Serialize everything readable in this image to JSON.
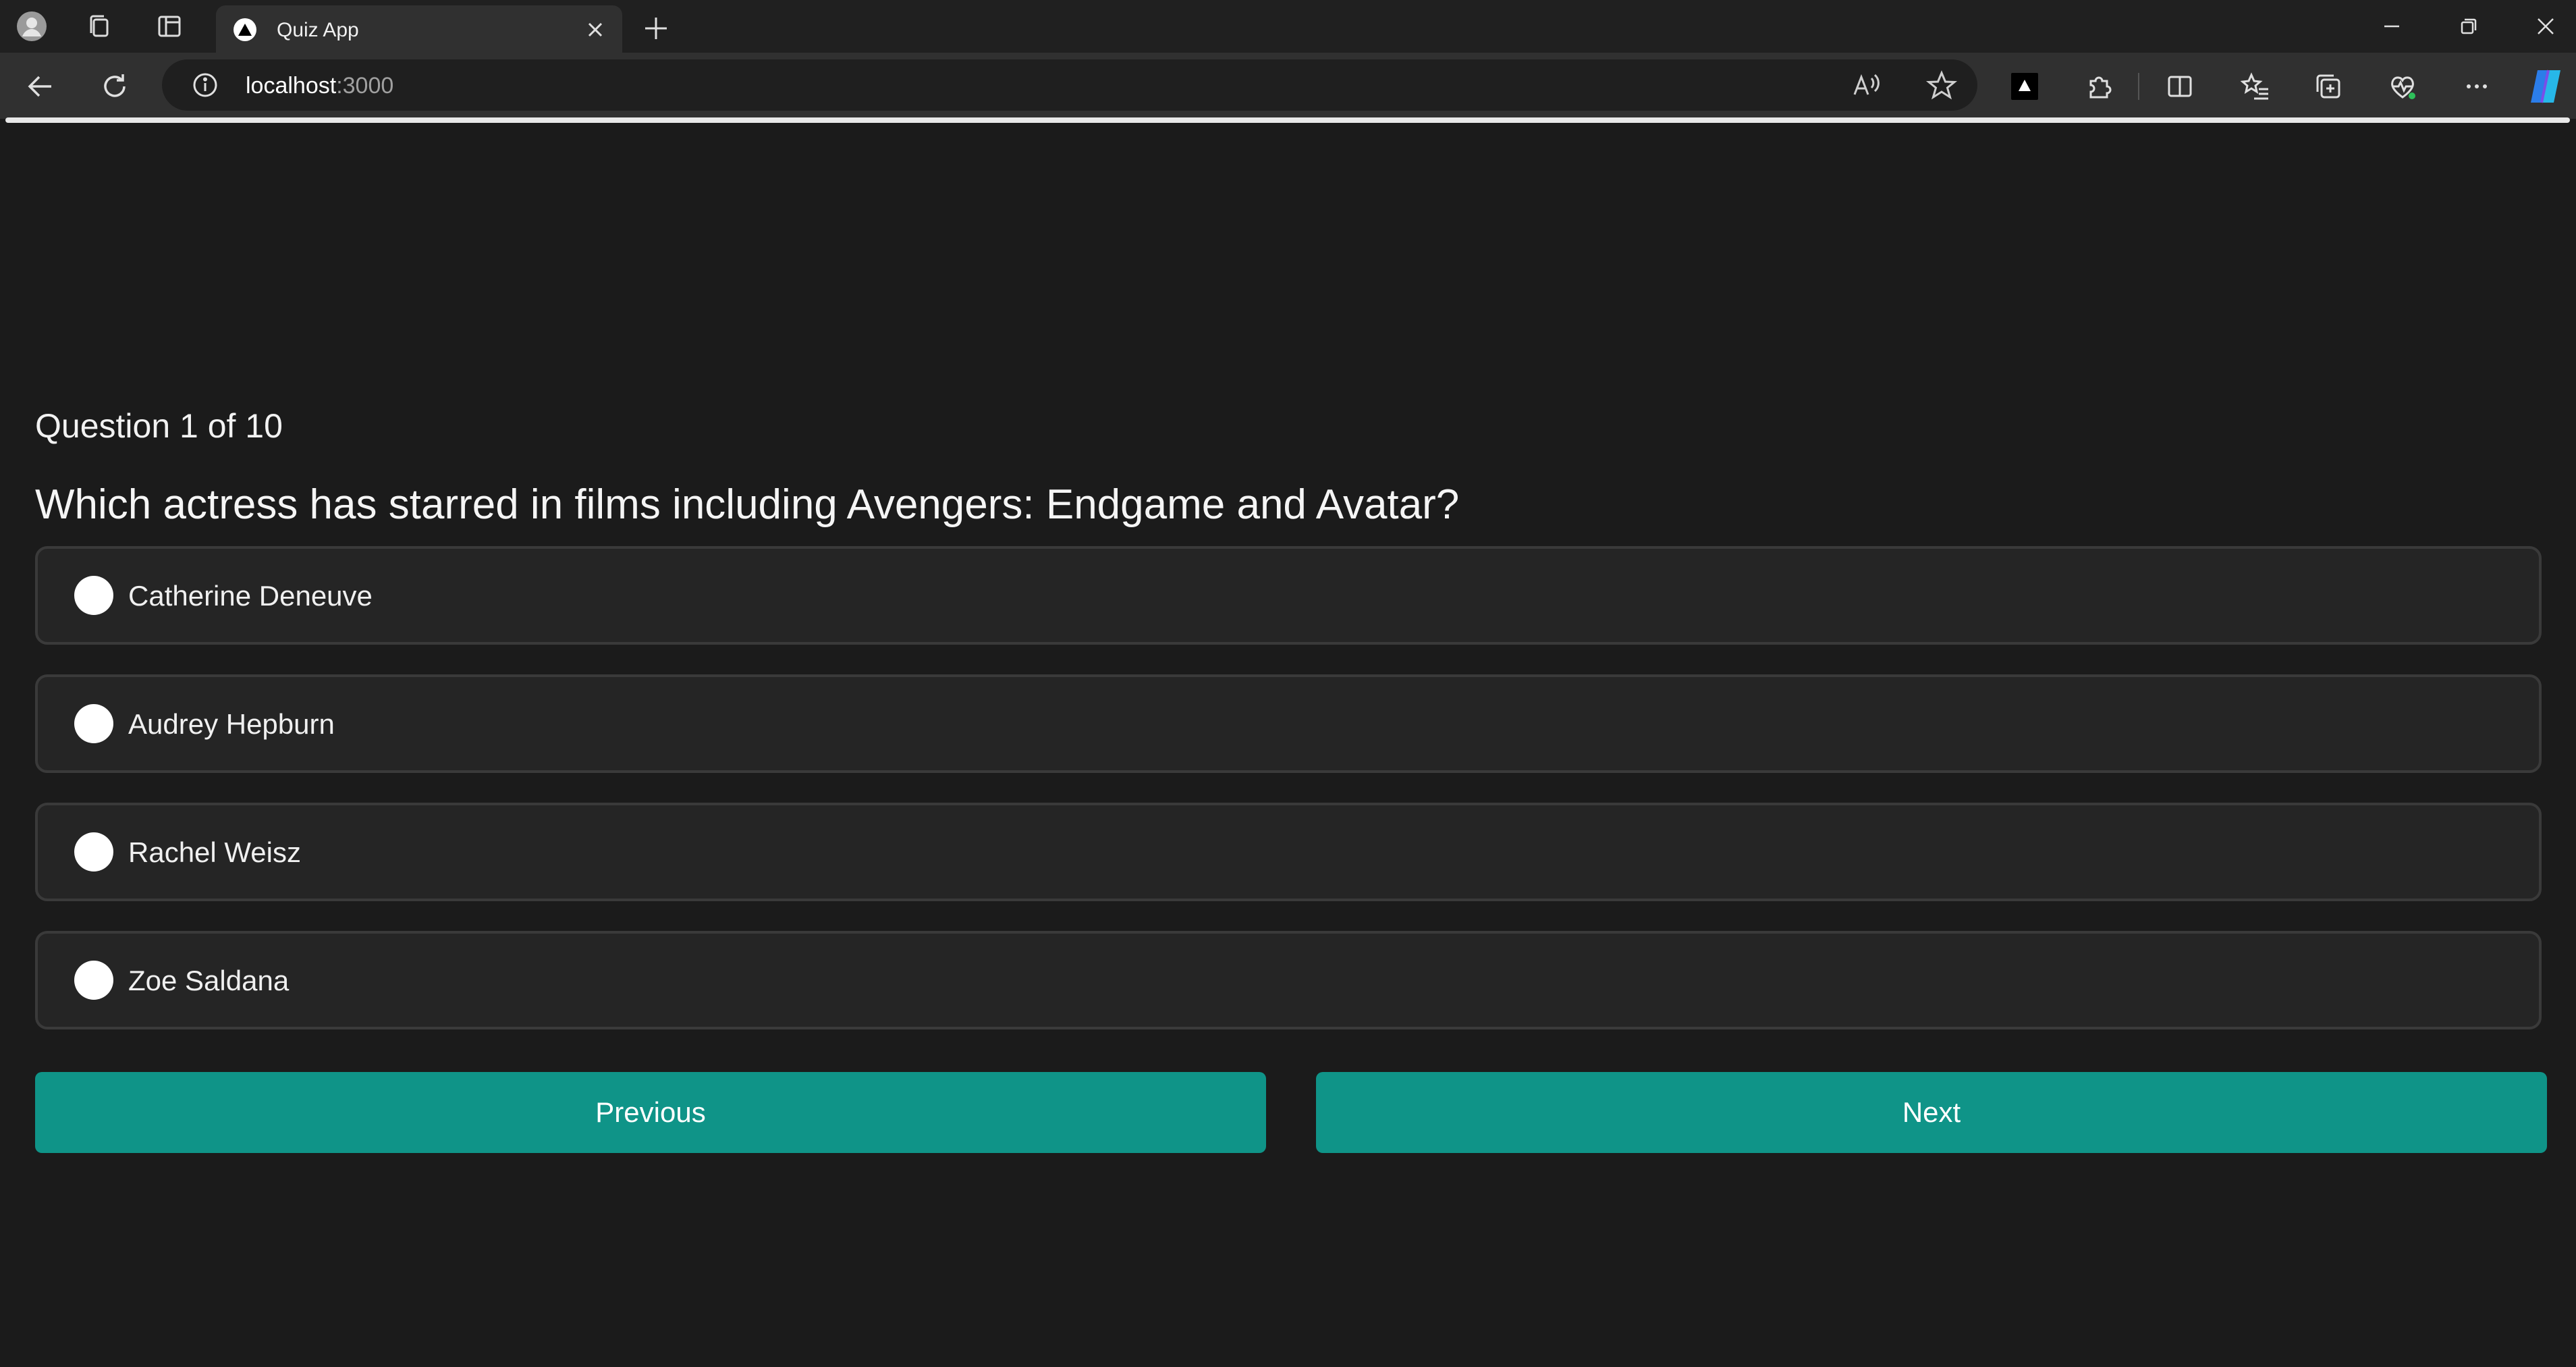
{
  "browser": {
    "tab_title": "Quiz App",
    "url_host": "localhost",
    "url_port": ":3000"
  },
  "quiz": {
    "progress": "Question 1 of 10",
    "question": "Which actress has starred in films including Avengers: Endgame and Avatar?",
    "options": [
      {
        "label": "Catherine Deneuve"
      },
      {
        "label": "Audrey Hepburn"
      },
      {
        "label": "Rachel Weisz"
      },
      {
        "label": "Zoe Saldana"
      }
    ],
    "previous_label": "Previous",
    "next_label": "Next"
  },
  "colors": {
    "accent": "#0f9488",
    "page_bg": "#1b1b1b",
    "option_bg": "#252525",
    "option_border": "#3a3a3a"
  }
}
